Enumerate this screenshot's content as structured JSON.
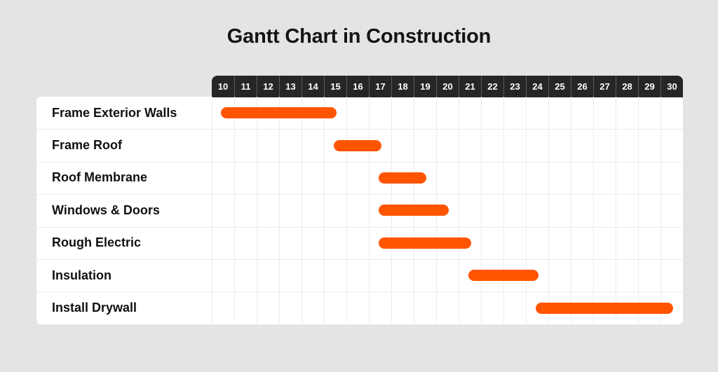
{
  "chart_data": {
    "type": "gantt",
    "title": "Gantt Chart in Construction",
    "xlabel": "",
    "ylabel": "",
    "x_ticks": [
      "10",
      "11",
      "12",
      "13",
      "14",
      "15",
      "16",
      "17",
      "18",
      "19",
      "20",
      "21",
      "22",
      "23",
      "24",
      "25",
      "26",
      "27",
      "28",
      "29",
      "30"
    ],
    "x_range": [
      10,
      30
    ],
    "grid": true,
    "bar_color": "#ff5500",
    "header_color": "#262626",
    "tasks": [
      {
        "name": "Frame Exterior Walls",
        "start": 10,
        "end": 15
      },
      {
        "name": "Frame Roof",
        "start": 15,
        "end": 17
      },
      {
        "name": "Roof Membrane",
        "start": 17,
        "end": 19
      },
      {
        "name": "Windows & Doors",
        "start": 17,
        "end": 20
      },
      {
        "name": "Rough Electric",
        "start": 17,
        "end": 21
      },
      {
        "name": "Insulation",
        "start": 21,
        "end": 24
      },
      {
        "name": "Install Drywall",
        "start": 24,
        "end": 30
      }
    ]
  }
}
